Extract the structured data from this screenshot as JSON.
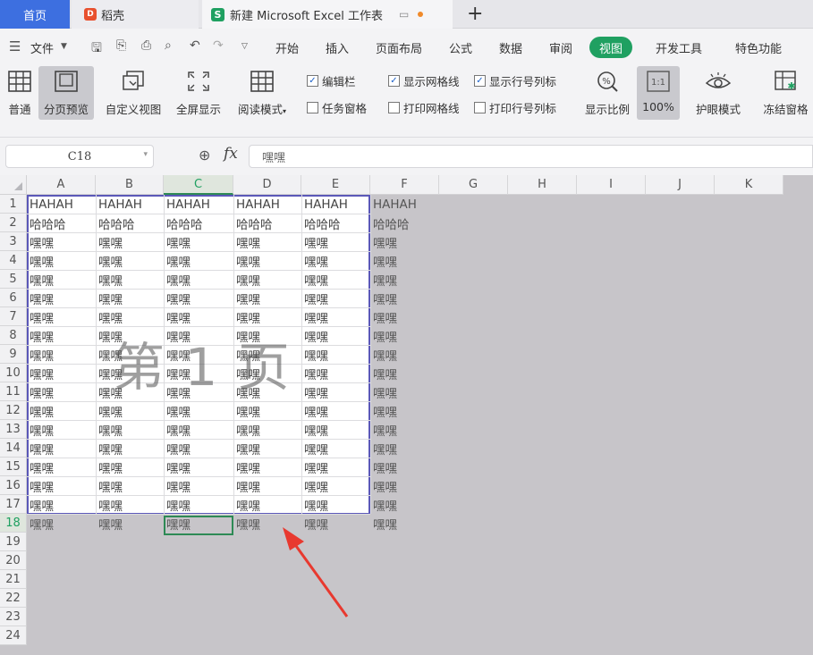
{
  "tabs": {
    "home": "首页",
    "daoke": "稻壳",
    "doc": "新建 Microsoft Excel 工作表",
    "new_tab": "+"
  },
  "menu": {
    "file": "文件",
    "items": [
      "开始",
      "插入",
      "页面布局",
      "公式",
      "数据",
      "审阅",
      "视图",
      "开发工具",
      "特色功能"
    ],
    "active": "视图"
  },
  "ribbon": {
    "buttons": [
      "普通",
      "分页预览",
      "自定义视图",
      "全屏显示",
      "阅读模式"
    ],
    "active_button": "分页预览",
    "checkboxes": {
      "formula_bar": {
        "label": "编辑栏",
        "checked": true
      },
      "task_pane": {
        "label": "任务窗格",
        "checked": false
      },
      "show_gridlines": {
        "label": "显示网格线",
        "checked": true
      },
      "print_gridlines": {
        "label": "打印网格线",
        "checked": false
      },
      "show_headers": {
        "label": "显示行号列标",
        "checked": true
      },
      "print_headers": {
        "label": "打印行号列标",
        "checked": false
      }
    },
    "zoom_button": "显示比例",
    "zoom100_button": "100%",
    "zoom100_icon_text": "1:1",
    "eye_button": "护眼模式",
    "freeze_button": "冻结窗格"
  },
  "formula_bar": {
    "name_box": "C18",
    "fx": "fx",
    "value": "嘿嘿"
  },
  "sheet": {
    "columns": [
      "A",
      "B",
      "C",
      "D",
      "E",
      "F",
      "G",
      "H",
      "I",
      "J",
      "K"
    ],
    "selected_column": "C",
    "rows": [
      "1",
      "2",
      "3",
      "4",
      "5",
      "6",
      "7",
      "8",
      "9",
      "10",
      "11",
      "12",
      "13",
      "14",
      "15",
      "16",
      "17",
      "18",
      "19",
      "20",
      "21",
      "22",
      "23",
      "24"
    ],
    "selected_row": "18",
    "row1": "HAHAH",
    "row2": "哈哈哈",
    "rowN": "嘿嘿",
    "watermark": "第 1 页"
  },
  "colors": {
    "accent_green": "#1fa061",
    "home_tab": "#3d6fe0",
    "page_border": "#5b58b8",
    "arrow": "#e8392f"
  }
}
